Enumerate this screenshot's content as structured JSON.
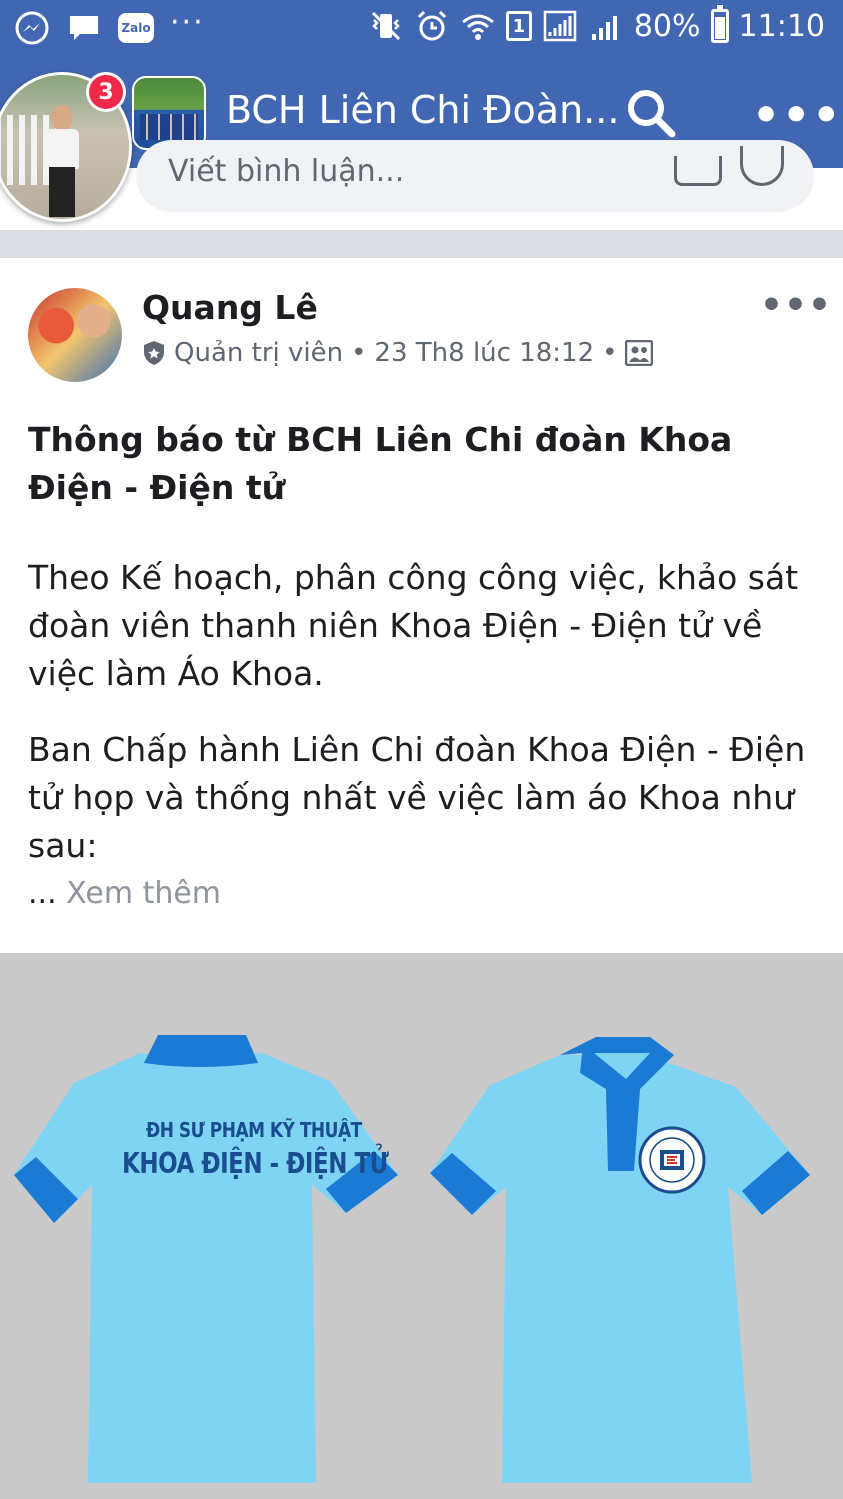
{
  "status_bar": {
    "battery": "80%",
    "time": "11:10",
    "sim_slot": "1",
    "zalo_label": "Zalo",
    "overflow": "···"
  },
  "nav": {
    "group_title": "BCH Liên Chi Đoàn...",
    "chat_badge_count": "3",
    "more": "•••"
  },
  "comment_box": {
    "placeholder": "Viết bình luận..."
  },
  "post": {
    "author": "Quang Lê",
    "role": "Quản trị viên",
    "separator": "•",
    "timestamp": "23 Th8 lúc 18:12",
    "more": "•••",
    "title": "Thông báo từ BCH Liên Chi đoàn Khoa Điện - Điện tử",
    "paragraph1": "Theo Kế hoạch, phân công công việc, khảo sát đoàn viên thanh niên Khoa Điện - Điện tử về việc làm Áo Khoa.",
    "paragraph2": "Ban Chấp hành Liên Chi đoàn Khoa Điện - Điện tử họp và thống nhất về việc làm áo Khoa như sau:",
    "ellipsis": "...",
    "see_more": "Xem thêm"
  },
  "photo": {
    "back_line1": "ĐH SƯ PHẠM KỸ THUẬT",
    "back_line2": "KHOA ĐIỆN - ĐIỆN TỬ"
  },
  "colors": {
    "facebook_blue": "#4267b2",
    "shirt_light": "#7fd4f4",
    "shirt_dark": "#1a7ad4",
    "badge_red": "#f02849"
  }
}
